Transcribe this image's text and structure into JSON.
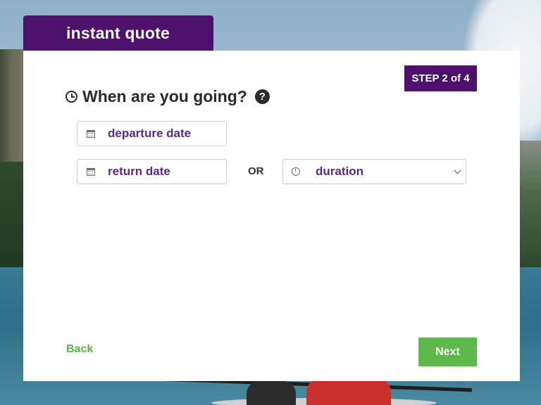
{
  "header": {
    "tab_title": "instant quote"
  },
  "step": {
    "badge": "STEP 2 of 4"
  },
  "question": {
    "text": "When are you going?",
    "help_glyph": "?"
  },
  "fields": {
    "departure_label": "departure date",
    "return_label": "return date",
    "separator": "OR",
    "duration_label": "duration"
  },
  "actions": {
    "back_label": "Back",
    "next_label": "Next"
  },
  "icons": {
    "question": "clock-icon",
    "help": "help-circle-icon",
    "departure": "calendar-icon",
    "return": "calendar-icon",
    "duration": "clock-icon",
    "dropdown": "chevron-down-icon"
  },
  "colors": {
    "brand_purple": "#4b116b",
    "field_text": "#5b2a86",
    "accent_green": "#5cb84a"
  }
}
